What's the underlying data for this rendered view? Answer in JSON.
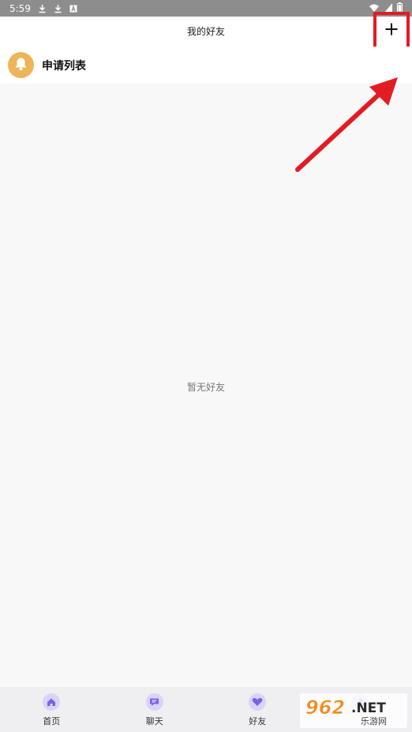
{
  "status_bar": {
    "time": "5:59",
    "left_icons": [
      "download-icon",
      "download-icon",
      "notification-a-icon"
    ],
    "right_icons": [
      "wifi-icon",
      "signal-icon",
      "battery-icon"
    ]
  },
  "header": {
    "title": "我的好友",
    "add_button_icon": "plus-icon"
  },
  "request_list": {
    "label": "申请列表",
    "icon": "bell-icon",
    "icon_bg_color": "#eeb45a"
  },
  "empty_state": {
    "text": "暂无好友"
  },
  "bottom_nav": {
    "items": [
      {
        "label": "首页",
        "icon": "home-icon"
      },
      {
        "label": "聊天",
        "icon": "chat-icon"
      },
      {
        "label": "好友",
        "icon": "heart-icon"
      },
      {
        "label": "",
        "icon": "profile-icon"
      }
    ]
  },
  "colors": {
    "accent": "#7b61e8",
    "annotation": "#e31b23"
  },
  "watermark": {
    "text_main": "962",
    "text_suffix": ".NET",
    "text_sub": "乐游网"
  }
}
